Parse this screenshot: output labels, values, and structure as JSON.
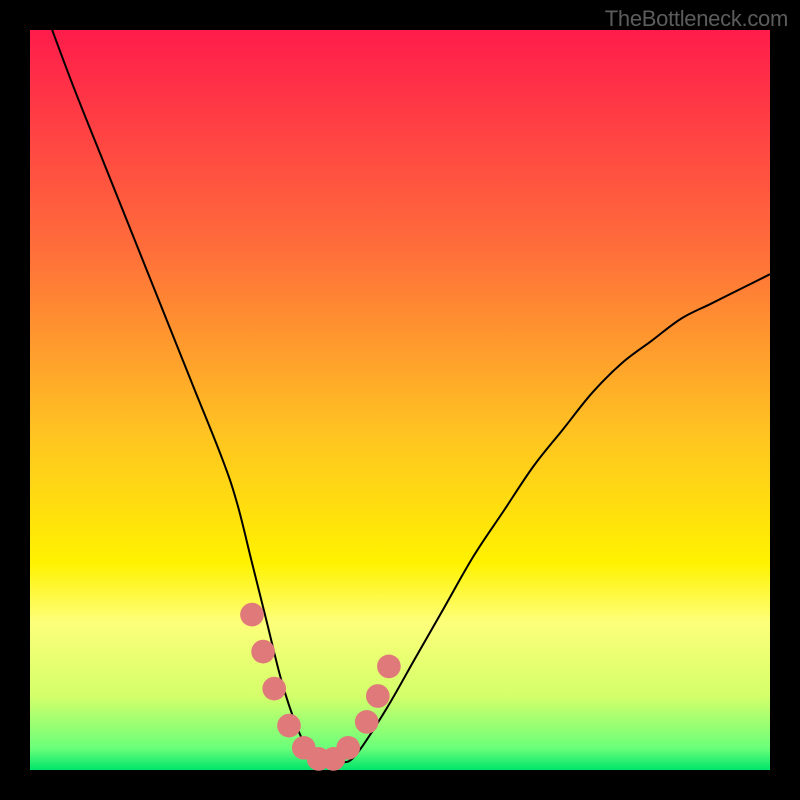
{
  "watermark": "TheBottleneck.com",
  "chart_data": {
    "type": "line",
    "title": "",
    "xlabel": "",
    "ylabel": "",
    "xlim": [
      0,
      100
    ],
    "ylim": [
      0,
      100
    ],
    "grid": false,
    "background": {
      "type": "gradient",
      "stops": [
        {
          "offset": 0,
          "color": "#ff1c4b"
        },
        {
          "offset": 30,
          "color": "#ff6f3a"
        },
        {
          "offset": 55,
          "color": "#ffc521"
        },
        {
          "offset": 72,
          "color": "#fff200"
        },
        {
          "offset": 80,
          "color": "#fdff7a"
        },
        {
          "offset": 90,
          "color": "#d4ff6a"
        },
        {
          "offset": 97,
          "color": "#6bff7a"
        },
        {
          "offset": 100,
          "color": "#00e56a"
        }
      ]
    },
    "series": [
      {
        "name": "bottleneck-curve",
        "color": "#000000",
        "x": [
          3,
          6,
          10,
          14,
          18,
          22,
          26,
          28,
          30,
          32,
          34,
          36,
          38,
          40,
          42,
          44,
          48,
          52,
          56,
          60,
          64,
          68,
          72,
          76,
          80,
          84,
          88,
          92,
          96,
          100
        ],
        "y": [
          100,
          92,
          82,
          72,
          62,
          52,
          42,
          36,
          28,
          20,
          12,
          6,
          2,
          1,
          1,
          2,
          8,
          15,
          22,
          29,
          35,
          41,
          46,
          51,
          55,
          58,
          61,
          63,
          65,
          67
        ]
      }
    ],
    "markers": {
      "name": "threshold-points",
      "color": "#e07a7a",
      "radius": 1.6,
      "points": [
        {
          "x": 30,
          "y": 21
        },
        {
          "x": 31.5,
          "y": 16
        },
        {
          "x": 33,
          "y": 11
        },
        {
          "x": 35,
          "y": 6
        },
        {
          "x": 37,
          "y": 3
        },
        {
          "x": 39,
          "y": 1.5
        },
        {
          "x": 41,
          "y": 1.5
        },
        {
          "x": 43,
          "y": 3
        },
        {
          "x": 45.5,
          "y": 6.5
        },
        {
          "x": 47,
          "y": 10
        },
        {
          "x": 48.5,
          "y": 14
        }
      ]
    }
  }
}
